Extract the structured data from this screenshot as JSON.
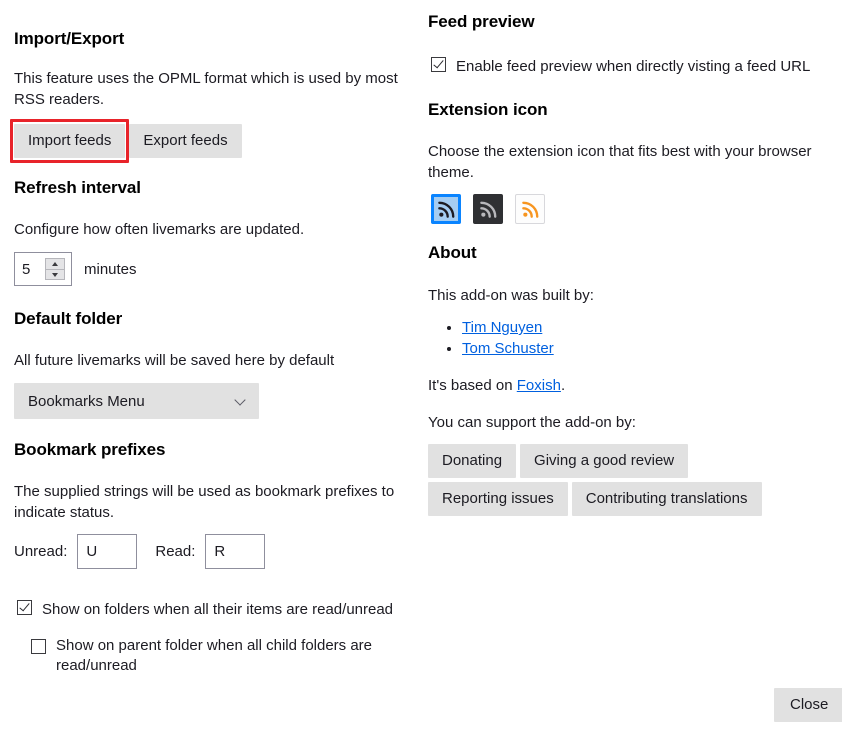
{
  "left": {
    "import_export": {
      "title": "Import/Export",
      "description": "This feature uses the OPML format which is used by most RSS readers.",
      "import_label": "Import feeds",
      "export_label": "Export feeds",
      "highlight_color": "#e8232a"
    },
    "refresh_interval": {
      "title": "Refresh interval",
      "description": "Configure how often livemarks are updated.",
      "value": "5",
      "units_label": "minutes"
    },
    "default_folder": {
      "title": "Default folder",
      "description": "All future livemarks will be saved here by default",
      "selected": "Bookmarks Menu"
    },
    "bookmark_prefixes": {
      "title": "Bookmark prefixes",
      "description": "The supplied strings will be used as bookmark prefixes to indicate status.",
      "unread_label": "Unread:",
      "unread_value": "U",
      "read_label": "Read:",
      "read_value": "R",
      "checkbox_folders_label": "Show on folders when all their items are read/unread",
      "checkbox_folders_checked": true,
      "checkbox_parent_label": "Show on parent folder when all child folders are read/unread",
      "checkbox_parent_checked": false
    }
  },
  "right": {
    "feed_preview": {
      "title": "Feed preview",
      "checkbox_label": "Enable feed preview when directly visting a feed URL",
      "checked": true
    },
    "extension_icon": {
      "title": "Extension icon",
      "description": "Choose the extension icon that fits best with your browser theme.",
      "options": [
        {
          "name": "rss-icon-blue",
          "background": "#a5cdf2",
          "glyph_color": "#1c1b22",
          "selected": true
        },
        {
          "name": "rss-icon-dark",
          "background": "#2f3033",
          "glyph_color": "#b8b8bc",
          "selected": false
        },
        {
          "name": "rss-icon-light",
          "background": "#fdfdfd",
          "glyph_color": "#f79520",
          "selected": false
        }
      ]
    },
    "about": {
      "title": "About",
      "built_by_label": "This add-on was built by:",
      "authors": [
        "Tim Nguyen",
        "Tom Schuster"
      ],
      "based_on_prefix": "It's based on ",
      "based_on_link": "Foxish",
      "based_on_suffix": ".",
      "support_label": "You can support the add-on by:",
      "support_buttons": [
        "Donating",
        "Giving a good review",
        "Reporting issues",
        "Contributing translations"
      ]
    }
  },
  "footer": {
    "close_label": "Close"
  }
}
